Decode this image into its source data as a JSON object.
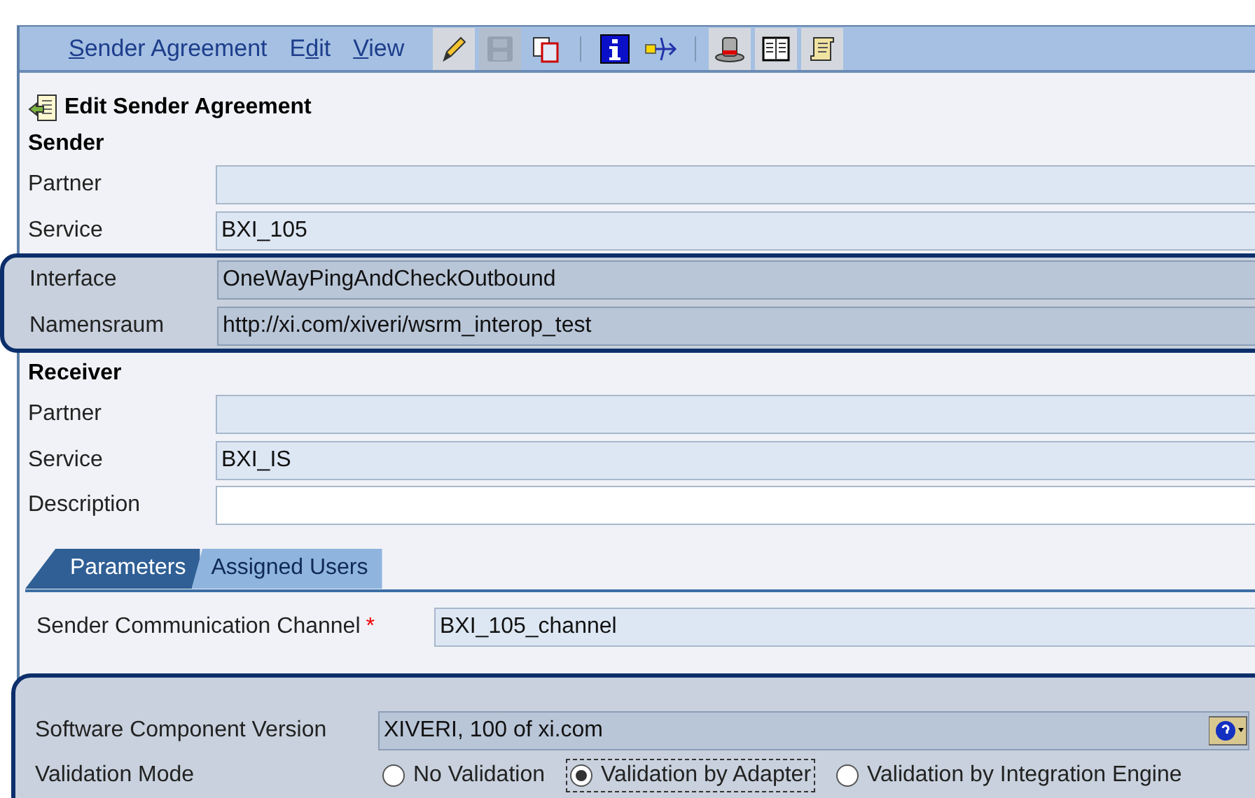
{
  "menu": [
    {
      "key": "S",
      "after": "ender Agreement"
    },
    {
      "before": "E",
      "key": "d",
      "after": "it"
    },
    {
      "key": "V",
      "after": "iew"
    }
  ],
  "toolbar": [
    {
      "kind": "edit",
      "pressed": true,
      "disabled": false
    },
    {
      "kind": "save",
      "pressed": false,
      "disabled": true
    },
    {
      "kind": "copy",
      "pressed": false,
      "disabled": false
    },
    {
      "kind": "separator"
    },
    {
      "kind": "info",
      "pressed": false,
      "disabled": false
    },
    {
      "kind": "route",
      "pressed": false,
      "disabled": false
    },
    {
      "kind": "separator"
    },
    {
      "kind": "hat",
      "pressed": true,
      "disabled": false
    },
    {
      "kind": "book",
      "pressed": true,
      "disabled": false
    },
    {
      "kind": "scroll",
      "pressed": true,
      "disabled": false
    }
  ],
  "page_title": "Edit Sender Agreement",
  "sender": {
    "heading": "Sender",
    "fields": [
      {
        "label": "Partner",
        "editable": false,
        "highlighted": false
      },
      {
        "label": "Service",
        "value": "BXI_105",
        "editable": false,
        "highlighted": false
      },
      {
        "label": "Interface",
        "value": "OneWayPingAndCheckOutbound",
        "editable": false,
        "highlighted": true
      },
      {
        "label": "Namensraum",
        "value": "http://xi.com/xiveri/wsrm_interop_test",
        "editable": false,
        "highlighted": true
      }
    ]
  },
  "receiver": {
    "heading": "Receiver",
    "fields": [
      {
        "label": "Partner",
        "editable": false,
        "highlighted": false
      },
      {
        "label": "Service",
        "value": "BXI_IS",
        "editable": false,
        "highlighted": false
      },
      {
        "label": "Description",
        "editable": true,
        "highlighted": false
      }
    ]
  },
  "tabs": [
    {
      "label": "Parameters",
      "selected": true
    },
    {
      "label": "Assigned Users",
      "selected": false
    }
  ],
  "channel": {
    "label": "Sender Communication Channel",
    "required_mark": "*",
    "value": "BXI_105_channel"
  },
  "software_component": {
    "label": "Software Component Version",
    "value": "XIVERI, 100 of xi.com"
  },
  "validation": {
    "label": "Validation Mode",
    "options": [
      {
        "label": "No Validation",
        "selected": false
      },
      {
        "label": "Validation by Adapter",
        "selected": true
      },
      {
        "label": "Validation by Integration Engine",
        "selected": false
      }
    ]
  }
}
